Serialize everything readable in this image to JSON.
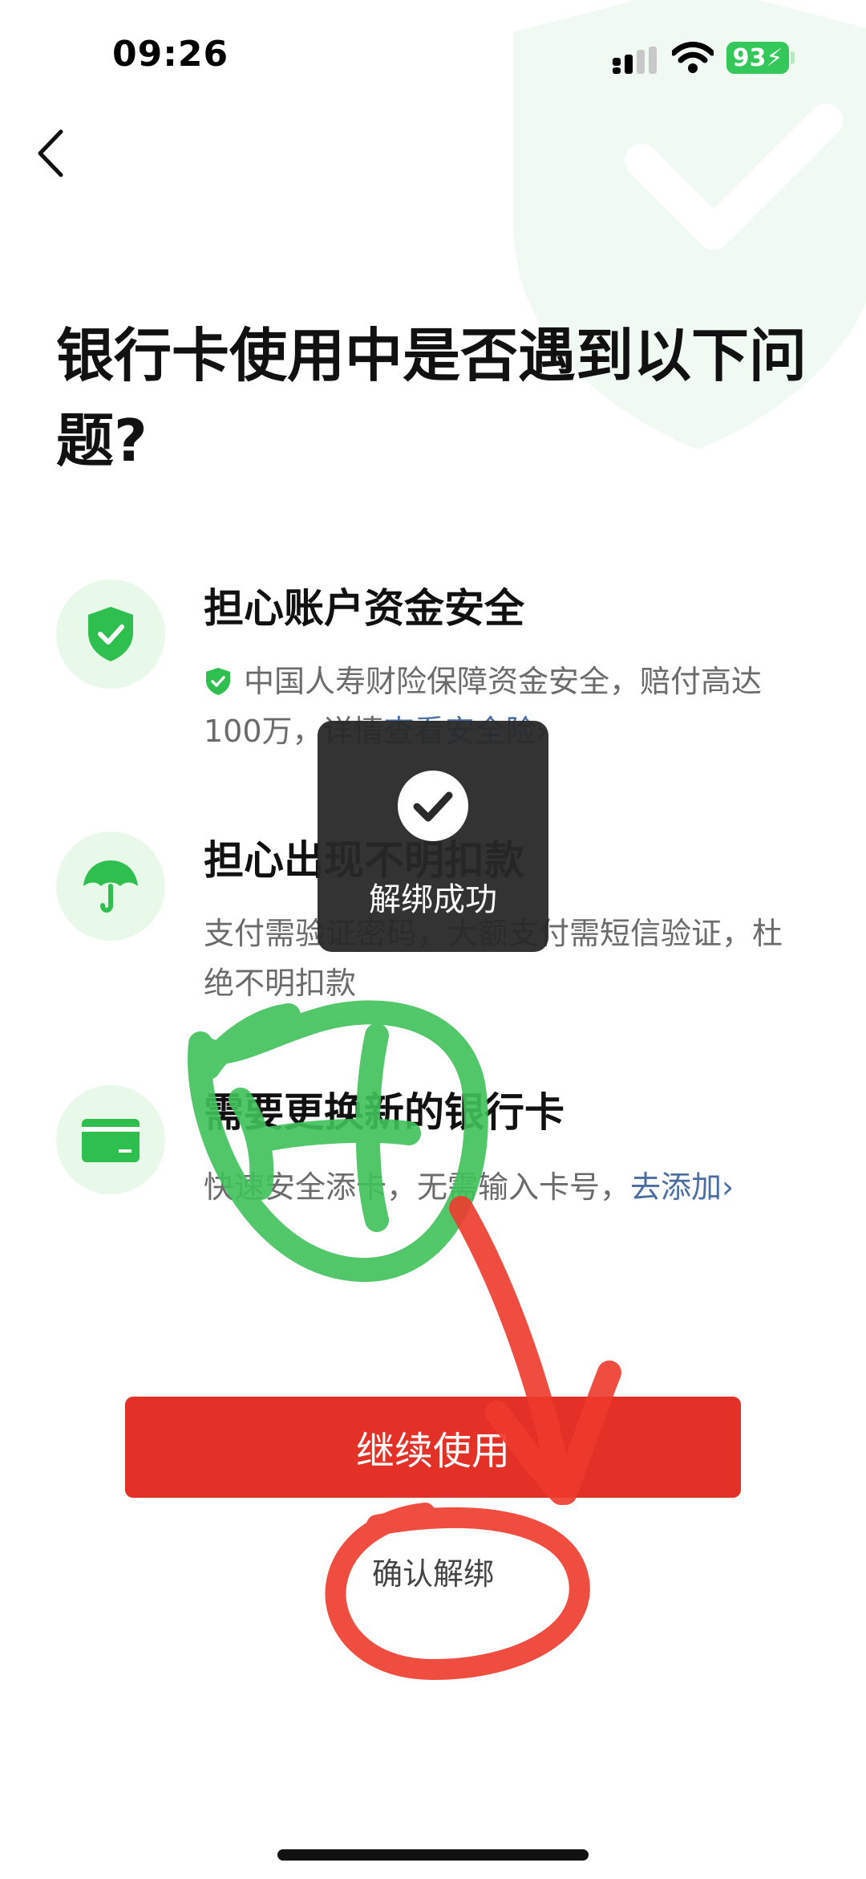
{
  "status_bar": {
    "time": "09:26",
    "battery": "93",
    "icons": [
      "signal-icon",
      "wifi-icon",
      "battery-charging-icon"
    ]
  },
  "nav": {
    "back_icon": "chevron-left-icon"
  },
  "page": {
    "title": "银行卡使用中是否遇到以下问题?"
  },
  "items": [
    {
      "icon": "shield-check-icon",
      "title": "担心账户资金安全",
      "desc_icon": "small-shield-check-icon",
      "desc": "中国人寿财险保障资金安全，赔付高达100万，详情",
      "link": "查看安全险",
      "chevron": "›"
    },
    {
      "icon": "umbrella-icon",
      "title": "担心出现不明扣款",
      "desc": "支付需验证密码，大额支付需短信验证，杜绝不明扣款"
    },
    {
      "icon": "card-icon",
      "title": "需要更换新的银行卡",
      "desc": "快速安全添卡，无需输入卡号，",
      "link": "去添加",
      "chevron": "›"
    }
  ],
  "actions": {
    "continue_label": "继续使用",
    "confirm_label": "确认解绑"
  },
  "toast": {
    "icon": "checkmark-circle-icon",
    "text": "解绑成功"
  },
  "colors": {
    "accent_green": "#2fbf4f",
    "primary_red": "#e33127",
    "link_blue": "#4a6ea1",
    "icon_bg": "#e8f9ea"
  }
}
